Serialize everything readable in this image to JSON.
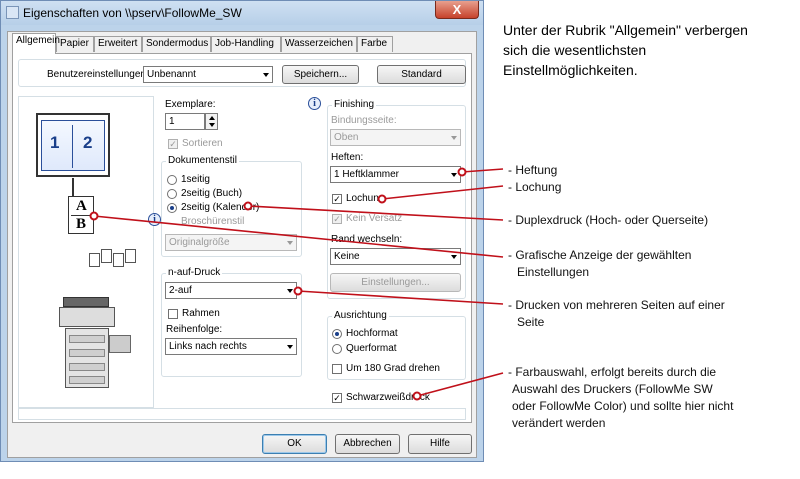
{
  "dialog": {
    "title": "Eigenschaften von \\\\pserv\\FollowMe_SW",
    "close_glyph": "X",
    "tabs": [
      "Allgemein",
      "Papier",
      "Erweitert",
      "Sondermodus",
      "Job-Handling",
      "Wasserzeichen",
      "Farbe"
    ],
    "active_tab": "Allgemein"
  },
  "top": {
    "settings_label": "Benutzereinstellungen:",
    "settings_value": "Unbenannt",
    "save_button": "Speichern...",
    "default_button": "Standard"
  },
  "preview": {
    "page1": "1",
    "page2": "2",
    "sheet_a": "A",
    "sheet_b": "B"
  },
  "copies": {
    "label": "Exemplare:",
    "value": "1",
    "collate_label": "Sortieren"
  },
  "doc_style": {
    "group_label": "Dokumentenstil",
    "options": [
      "1seitig",
      "2seitig (Buch)",
      "2seitig (Kalender)",
      "Broschürenstil"
    ],
    "selected": "2seitig (Kalender)",
    "size_value": "Originalgröße"
  },
  "n_up": {
    "group_label": "n-auf-Druck",
    "value": "2-auf",
    "border_label": "Rahmen",
    "order_label": "Reihenfolge:",
    "order_value": "Links nach rechts"
  },
  "finishing": {
    "group_label": "Finishing",
    "binding_label": "Bindungsseite:",
    "binding_value": "Oben",
    "staple_label": "Heften:",
    "staple_value": "1 Heftklammer",
    "punch_label": "Lochung",
    "offset_label": "Kein Versatz",
    "margin_label": "Rand wechseln:",
    "margin_value": "Keine",
    "settings_button": "Einstellungen..."
  },
  "orientation": {
    "group_label": "Ausrichtung",
    "portrait": "Hochformat",
    "landscape": "Querformat",
    "rotate_label": "Um 180 Grad drehen"
  },
  "bw_label": "Schwarzweißdruck",
  "footer": {
    "ok": "OK",
    "cancel": "Abbrechen",
    "help": "Hilfe"
  },
  "annotations": {
    "intro": [
      "Unter der Rubrik \"Allgemein\" verbergen",
      "sich die wesentlichsten",
      "Einstellmöglichkeiten."
    ],
    "heftung": "- Heftung",
    "lochung": "- Lochung",
    "duplex": "- Duplexdruck (Hoch- oder Querseite)",
    "grafik": [
      "- Grafische Anzeige der gewählten",
      "Einstellungen"
    ],
    "nup": [
      "- Drucken von mehreren Seiten auf einer",
      "Seite"
    ],
    "farbe": [
      "- Farbauswahl, erfolgt bereits durch die",
      "Auswahl des Druckers (FollowMe SW",
      "oder  FollowMe Color) und sollte hier nicht",
      "verändert werden"
    ]
  },
  "colors": {
    "annotation_line": "#c0101a",
    "title_bar": "#bcd3ea",
    "dialog_face": "#f0f0f0"
  }
}
